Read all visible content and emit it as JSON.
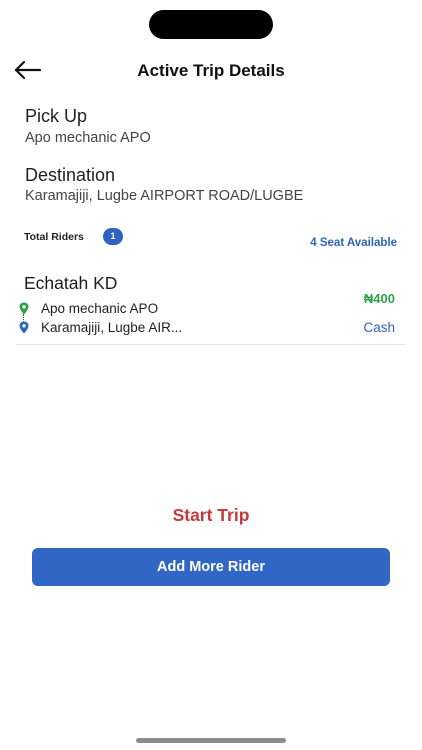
{
  "header": {
    "title": "Active Trip Details",
    "back_icon": "arrow-left-icon"
  },
  "pickup": {
    "label": "Pick Up",
    "value": "Apo mechanic APO"
  },
  "destination": {
    "label": "Destination",
    "value": "Karamajiji, Lugbe AIRPORT ROAD/LUGBE"
  },
  "riders": {
    "label": "Total Riders",
    "count": "1",
    "seats_available": "4 Seat Available"
  },
  "rider_card": {
    "name": "Echatah KD",
    "pickup": "Apo mechanic APO",
    "dropoff": "Karamajiji, Lugbe AIR...",
    "fare": "₦400",
    "payment_method": "Cash",
    "pickup_icon": "green-location-pin-icon",
    "dropoff_icon": "blue-location-pin-icon"
  },
  "actions": {
    "start_trip": "Start Trip",
    "add_more_rider": "Add More Rider"
  },
  "colors": {
    "accent_blue": "#3166c4",
    "start_red": "#c6393b",
    "fare_green": "#2ea24a"
  }
}
